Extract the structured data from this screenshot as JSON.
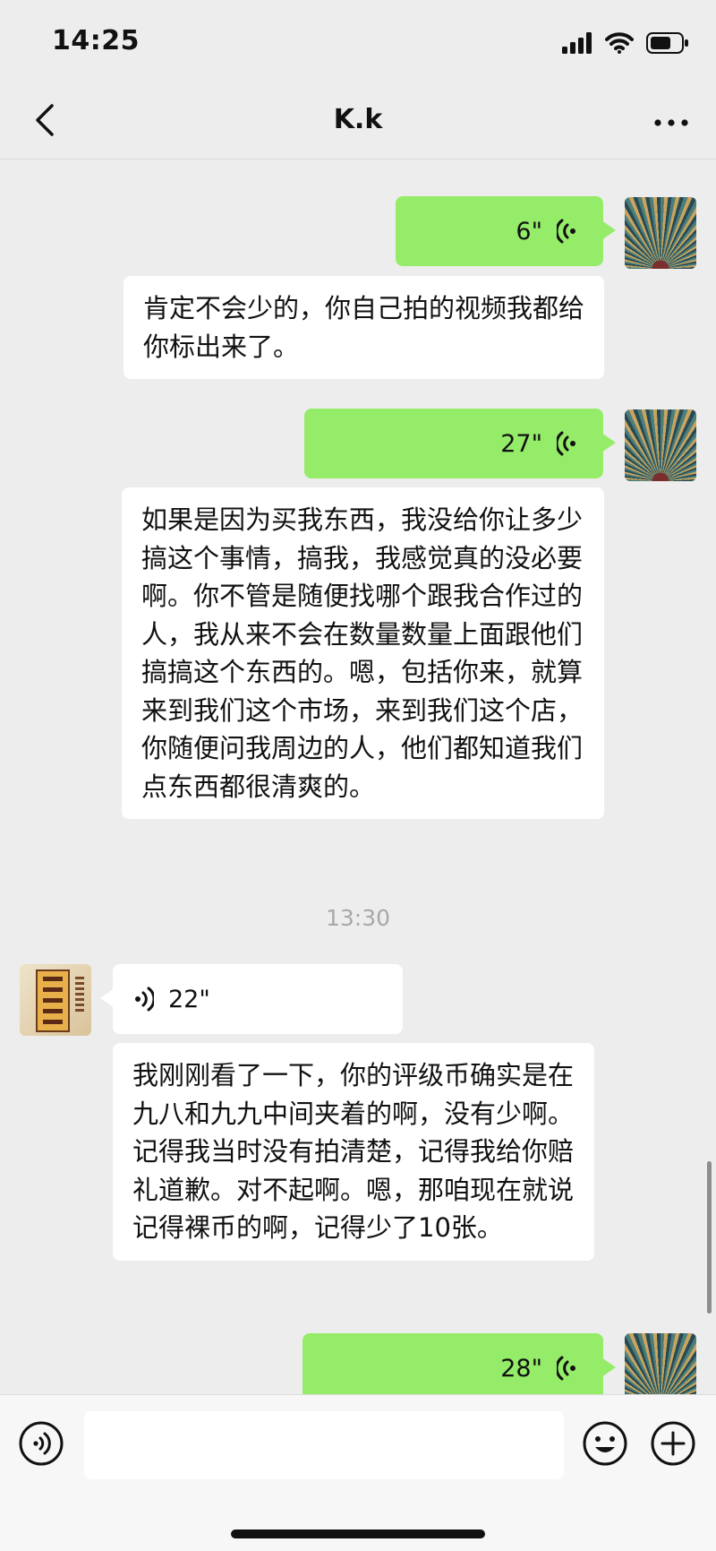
{
  "status_bar": {
    "time": "14:25",
    "icons": [
      "signal-icon",
      "wifi-icon",
      "battery-icon"
    ]
  },
  "nav": {
    "title": "K.k",
    "back_icon": "chevron-left-icon",
    "more_icon": "more-dots-icon"
  },
  "messages": [
    {
      "type": "voice",
      "sender": "me",
      "duration": "6\""
    },
    {
      "type": "text",
      "sender": "me",
      "text": "肯定不会少的，你自己拍的视频我都给你标出来了。"
    },
    {
      "type": "voice",
      "sender": "me",
      "duration": "27\""
    },
    {
      "type": "text",
      "sender": "me",
      "text": "如果是因为买我东西，我没给你让多少搞这个事情，搞我，我感觉真的没必要啊。你不管是随便找哪个跟我合作过的人，我从来不会在数量数量上面跟他们搞搞这个东西的。嗯，包括你来，就算来到我们这个市场，来到我们这个店，你随便问我周边的人，他们都知道我们点东西都很清爽的。"
    },
    {
      "type": "time",
      "text": "13:30"
    },
    {
      "type": "voice",
      "sender": "other",
      "duration": "22\""
    },
    {
      "type": "text",
      "sender": "other",
      "text": "我刚刚看了一下，你的评级币确实是在九八和九九中间夹着的啊，没有少啊。记得我当时没有拍清楚，记得我给你赔礼道歉。对不起啊。嗯，那咱现在就说记得裸币的啊，记得少了10张。"
    },
    {
      "type": "voice",
      "sender": "me",
      "duration": "28\""
    }
  ],
  "input_bar": {
    "voice_icon": "voice-mode-icon",
    "emoji_icon": "emoji-icon",
    "plus_icon": "plus-icon",
    "placeholder": ""
  },
  "colors": {
    "background": "#ededed",
    "sent_bubble": "#95ec69",
    "received_bubble": "#ffffff",
    "timestamp": "#a8a8a8"
  }
}
